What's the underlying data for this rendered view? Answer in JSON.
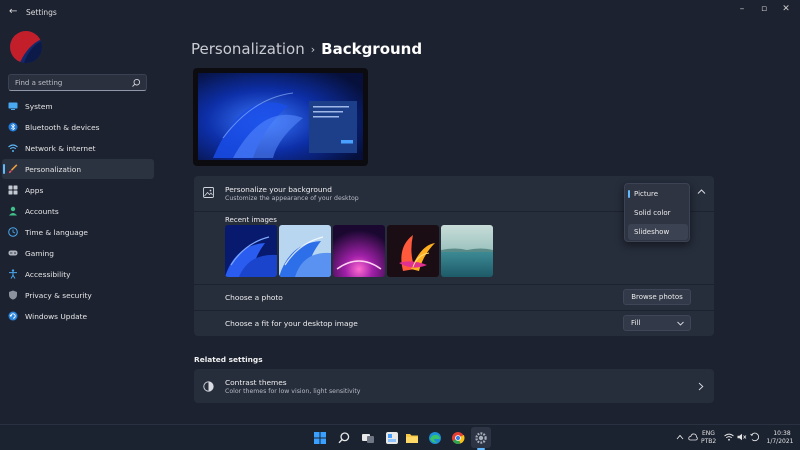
{
  "window": {
    "title": "Settings"
  },
  "sidebar": {
    "search_placeholder": "Find a setting",
    "items": [
      {
        "label": "System",
        "icon": "monitor-icon",
        "active": false
      },
      {
        "label": "Bluetooth & devices",
        "icon": "bluetooth-icon",
        "active": false
      },
      {
        "label": "Network & internet",
        "icon": "wifi-icon",
        "active": false
      },
      {
        "label": "Personalization",
        "icon": "brush-icon",
        "active": true
      },
      {
        "label": "Apps",
        "icon": "apps-icon",
        "active": false
      },
      {
        "label": "Accounts",
        "icon": "person-icon",
        "active": false
      },
      {
        "label": "Time & language",
        "icon": "clock-globe-icon",
        "active": false
      },
      {
        "label": "Gaming",
        "icon": "gamepad-icon",
        "active": false
      },
      {
        "label": "Accessibility",
        "icon": "accessibility-icon",
        "active": false
      },
      {
        "label": "Privacy & security",
        "icon": "shield-icon",
        "active": false
      },
      {
        "label": "Windows Update",
        "icon": "update-icon",
        "active": false
      }
    ]
  },
  "breadcrumb": {
    "parent": "Personalization",
    "separator": "›",
    "current": "Background"
  },
  "background_section": {
    "title": "Personalize your background",
    "subtitle": "Customize the appearance of your desktop",
    "dropdown_options": [
      "Picture",
      "Solid color",
      "Slideshow"
    ],
    "selected_option": "Picture",
    "recent_images_label": "Recent images",
    "recent_images": [
      "bloom-blue-dark",
      "bloom-blue-light",
      "purple-glow",
      "flower-colorful",
      "lake-sunrise"
    ],
    "choose_photo_label": "Choose a photo",
    "browse_button": "Browse photos",
    "fit_label": "Choose a fit for your desktop image",
    "fit_value": "Fill"
  },
  "related": {
    "heading": "Related settings",
    "items": [
      {
        "title": "Contrast themes",
        "subtitle": "Color themes for low vision, light sensitivity",
        "icon": "contrast-icon"
      }
    ]
  },
  "taskbar": {
    "apps": [
      "start-icon",
      "search-icon",
      "task-view-icon",
      "widgets-icon",
      "file-explorer-icon",
      "edge-icon",
      "chrome-icon",
      "settings-icon"
    ],
    "language": "ENG",
    "keyboard": "PTB2",
    "time": "10:38",
    "date": "1/7/2021"
  },
  "colors": {
    "accent": "#60b8ff",
    "background": "#1c2230",
    "card": "#262d3b"
  }
}
